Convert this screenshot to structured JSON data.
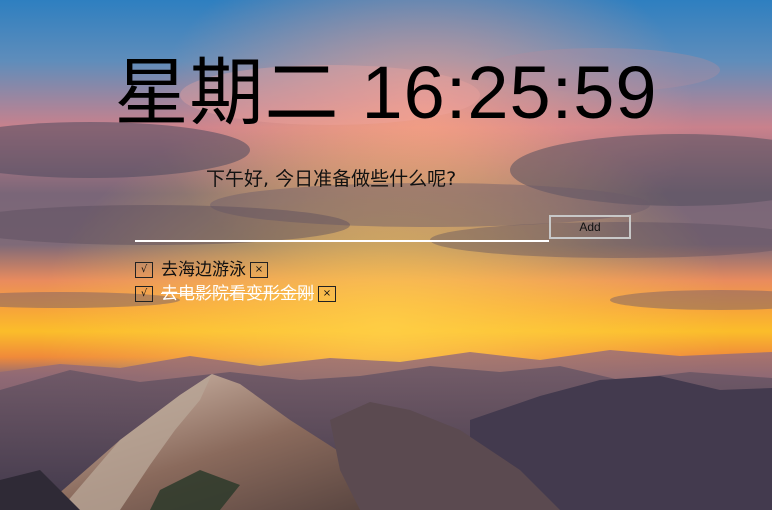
{
  "clock": {
    "day": "星期二",
    "time": "16:25:59"
  },
  "greeting": "下午好, 今日准备做些什么呢?",
  "add_form": {
    "input_value": "",
    "add_label": "Add"
  },
  "todos": [
    {
      "text": "去海边游泳",
      "check_symbol": "√",
      "delete_symbol": "×",
      "completed": false
    },
    {
      "text": "去电影院看变形金刚",
      "check_symbol": "√",
      "delete_symbol": "×",
      "completed": true
    }
  ],
  "colors": {
    "text_dark": "#000000",
    "text_light": "#ffffff",
    "input_underline": "#ffffff",
    "button_border": "#c8c8c8"
  },
  "icons": {
    "check": "check-icon",
    "delete": "close-icon"
  }
}
